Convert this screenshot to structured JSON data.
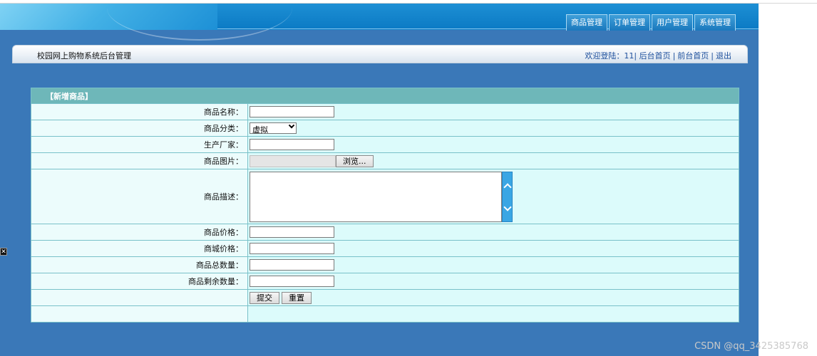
{
  "nav": {
    "tabs": [
      "商品管理",
      "订单管理",
      "用户管理",
      "系统管理"
    ]
  },
  "strip": {
    "title": "校园网上购物系统后台管理",
    "welcome": "欢迎登陆：11|",
    "links": [
      "后台首页",
      "前台首页",
      "退出"
    ],
    "separator": "|"
  },
  "form": {
    "caption": "【新增商品】",
    "labels": {
      "name": "商品名称：",
      "category": "商品分类：",
      "manufacturer": "生产厂家：",
      "image": "商品图片：",
      "description": "商品描述：",
      "price": "商品价格：",
      "mall_price": "商城价格：",
      "total_qty": "商品总数量：",
      "remain_qty": "商品剩余数量："
    },
    "category_value": "虚拟",
    "browse_label": "浏览...",
    "submit_label": "提交",
    "reset_label": "重置"
  },
  "watermark": "CSDN @qq_3425385768",
  "close_icon_glyph": "✕",
  "colors": {
    "app_background": "#3a78b8",
    "caption_background": "#6eb7b9",
    "row_background": "#dcfbfb"
  }
}
